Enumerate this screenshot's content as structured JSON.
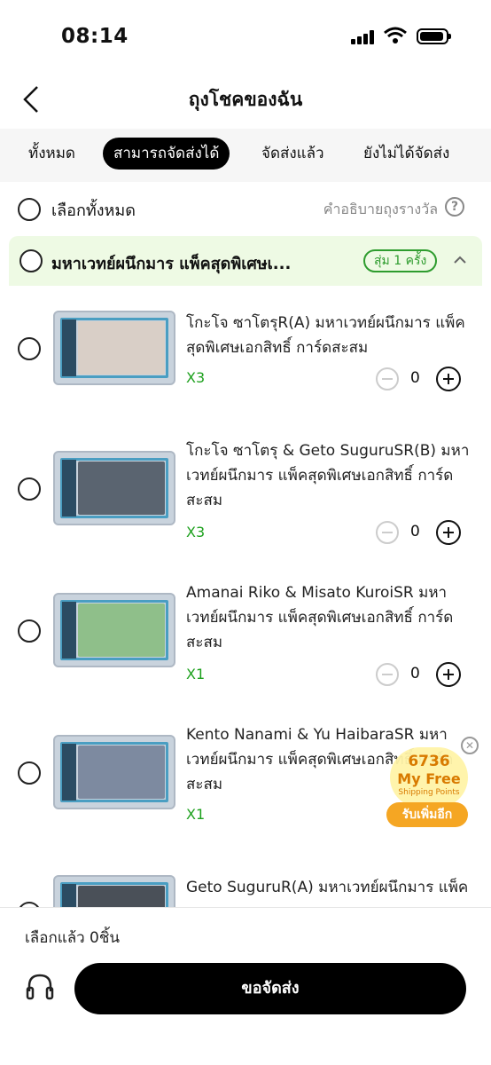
{
  "status": {
    "time": "08:14"
  },
  "nav": {
    "title": "ถุงโชคของฉัน"
  },
  "tabs": [
    {
      "label": "ทั้งหมด",
      "active": false
    },
    {
      "label": "สามารถจัดส่งได้",
      "active": true
    },
    {
      "label": "จัดส่งแล้ว",
      "active": false
    },
    {
      "label": "ยังไม่ได้จัดส่ง",
      "active": false
    }
  ],
  "select_all": {
    "label": "เลือกทั้งหมด",
    "description": "คำอธิบายถุงรางวัล"
  },
  "group": {
    "title": "มหาเวทย์ผนึกมาร แพ็คสุดพิเศษเ...",
    "badge": "สุ่ม 1 ครั้ง"
  },
  "items": [
    {
      "name": "โกะโจ ซาโตรุR(A) มหาเวทย์ผนึกมาร แพ็คสุดพิเศษเอกสิทธิ์ การ์ดสะสม",
      "qty_label": "X3",
      "count": "0"
    },
    {
      "name": "โกะโจ ซาโตรุ & Geto SuguruSR(B) มหาเวทย์ผนึกมาร แพ็คสุดพิเศษเอกสิทธิ์ การ์ดสะสม",
      "qty_label": "X3",
      "count": "0"
    },
    {
      "name": "Amanai Riko & Misato KuroiSR มหาเวทย์ผนึกมาร แพ็คสุดพิเศษเอกสิทธิ์ การ์ดสะสม",
      "qty_label": "X1",
      "count": "0"
    },
    {
      "name": "Kento Nanami & Yu HaibaraSR มหาเวทย์ผนึกมาร แพ็คสุดพิเศษเอกสิทธิ์ การ์ดสะสม",
      "qty_label": "X1",
      "count": "0"
    },
    {
      "name": "Geto SuguruR(A) มหาเวทย์ผนึกมาร แพ็ค",
      "qty_label": "",
      "count": ""
    }
  ],
  "promo": {
    "points": "6736",
    "title": "My Free",
    "subtitle": "Shipping Points",
    "button": "รับเพิ่มอีก"
  },
  "bottom": {
    "selected_text": "เลือกแล้ว 0ชิ้น",
    "ship_button": "ขอจัดส่ง"
  },
  "colors": {
    "active_tab": "#000000",
    "group_bg": "#eefae4",
    "badge": "#2e9c2e",
    "qty_green": "#1ea11e",
    "promo_orange": "#f5a623"
  }
}
